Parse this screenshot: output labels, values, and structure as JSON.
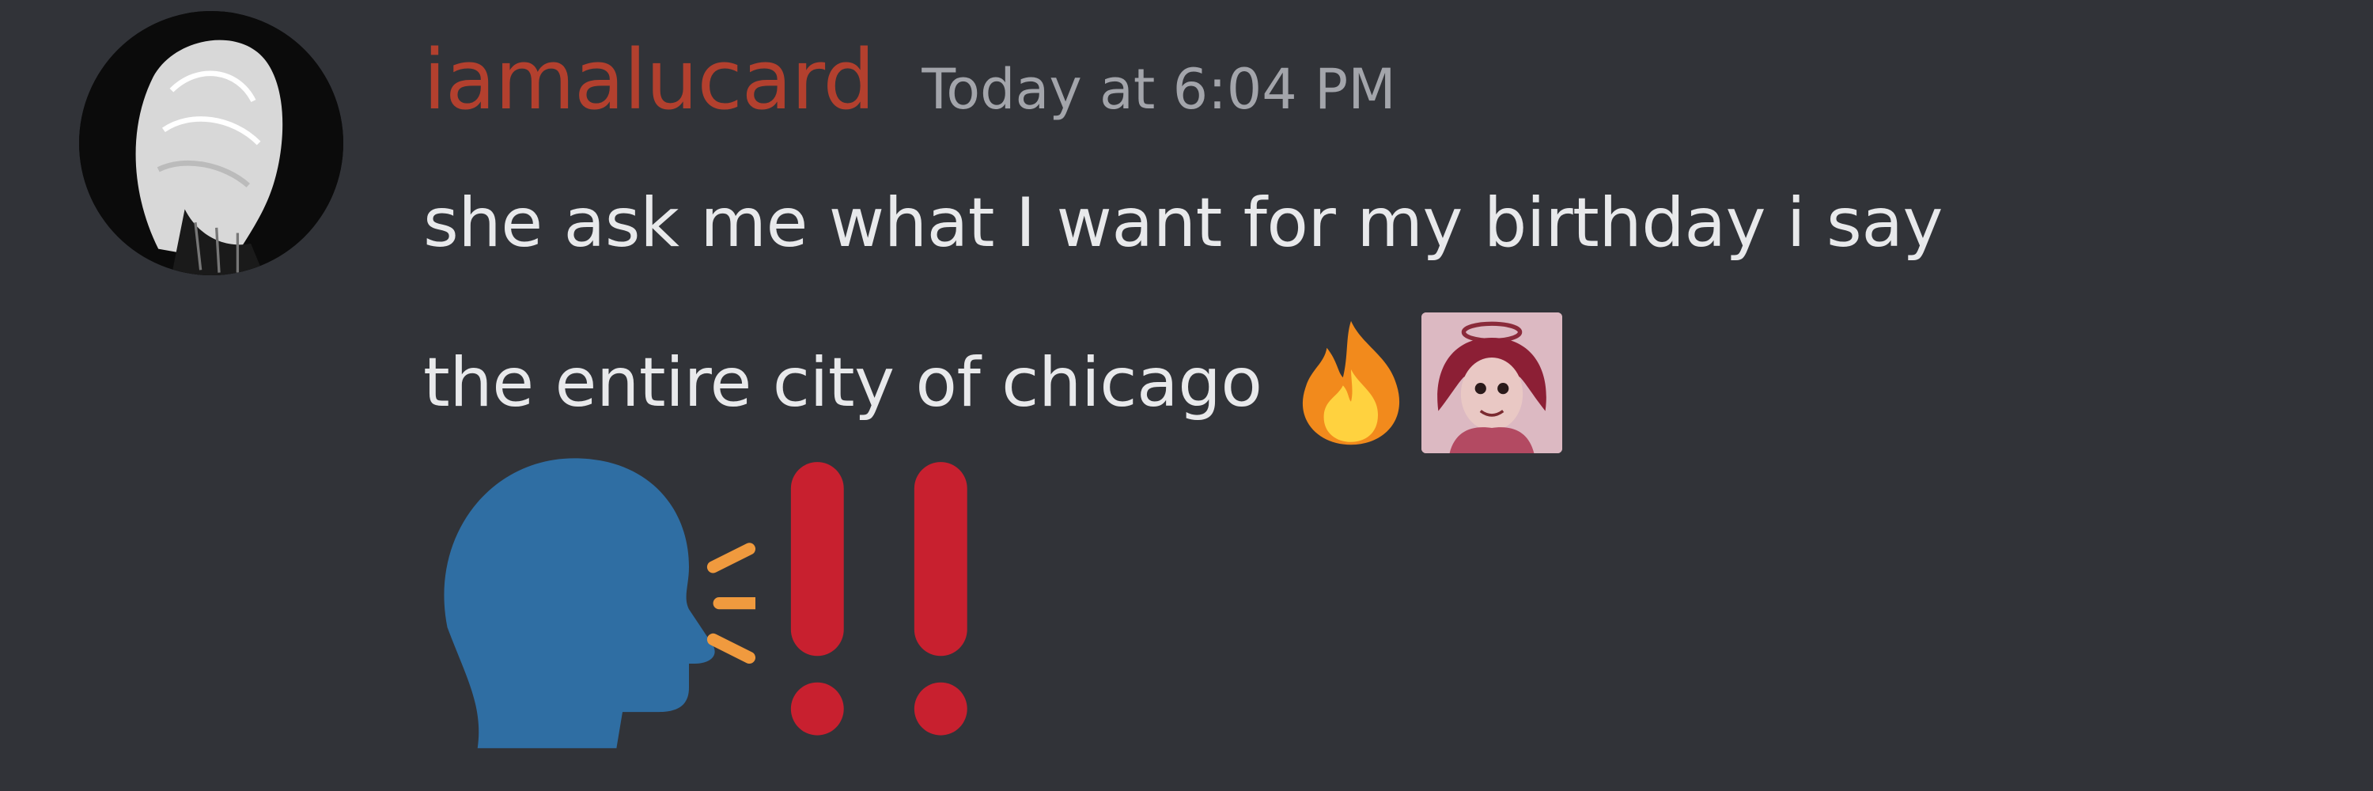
{
  "message": {
    "author": "iamalucard",
    "timestamp": "Today at 6:04 PM",
    "text_line1": "she ask me what I want for my birthday i say",
    "text_line2": "the entire city of chicago",
    "inline_emojis": [
      "fire-emoji",
      "custom-character-emoji"
    ],
    "large_emojis": [
      "speaking-head-emoji",
      "double-exclamation-emoji"
    ]
  },
  "colors": {
    "background": "#313338",
    "username": "#b3402e",
    "timestamp": "#a3a5ab",
    "text": "#e8e9eb",
    "speaking_head": "#2f6ea3",
    "exclamation": "#c8202f"
  }
}
